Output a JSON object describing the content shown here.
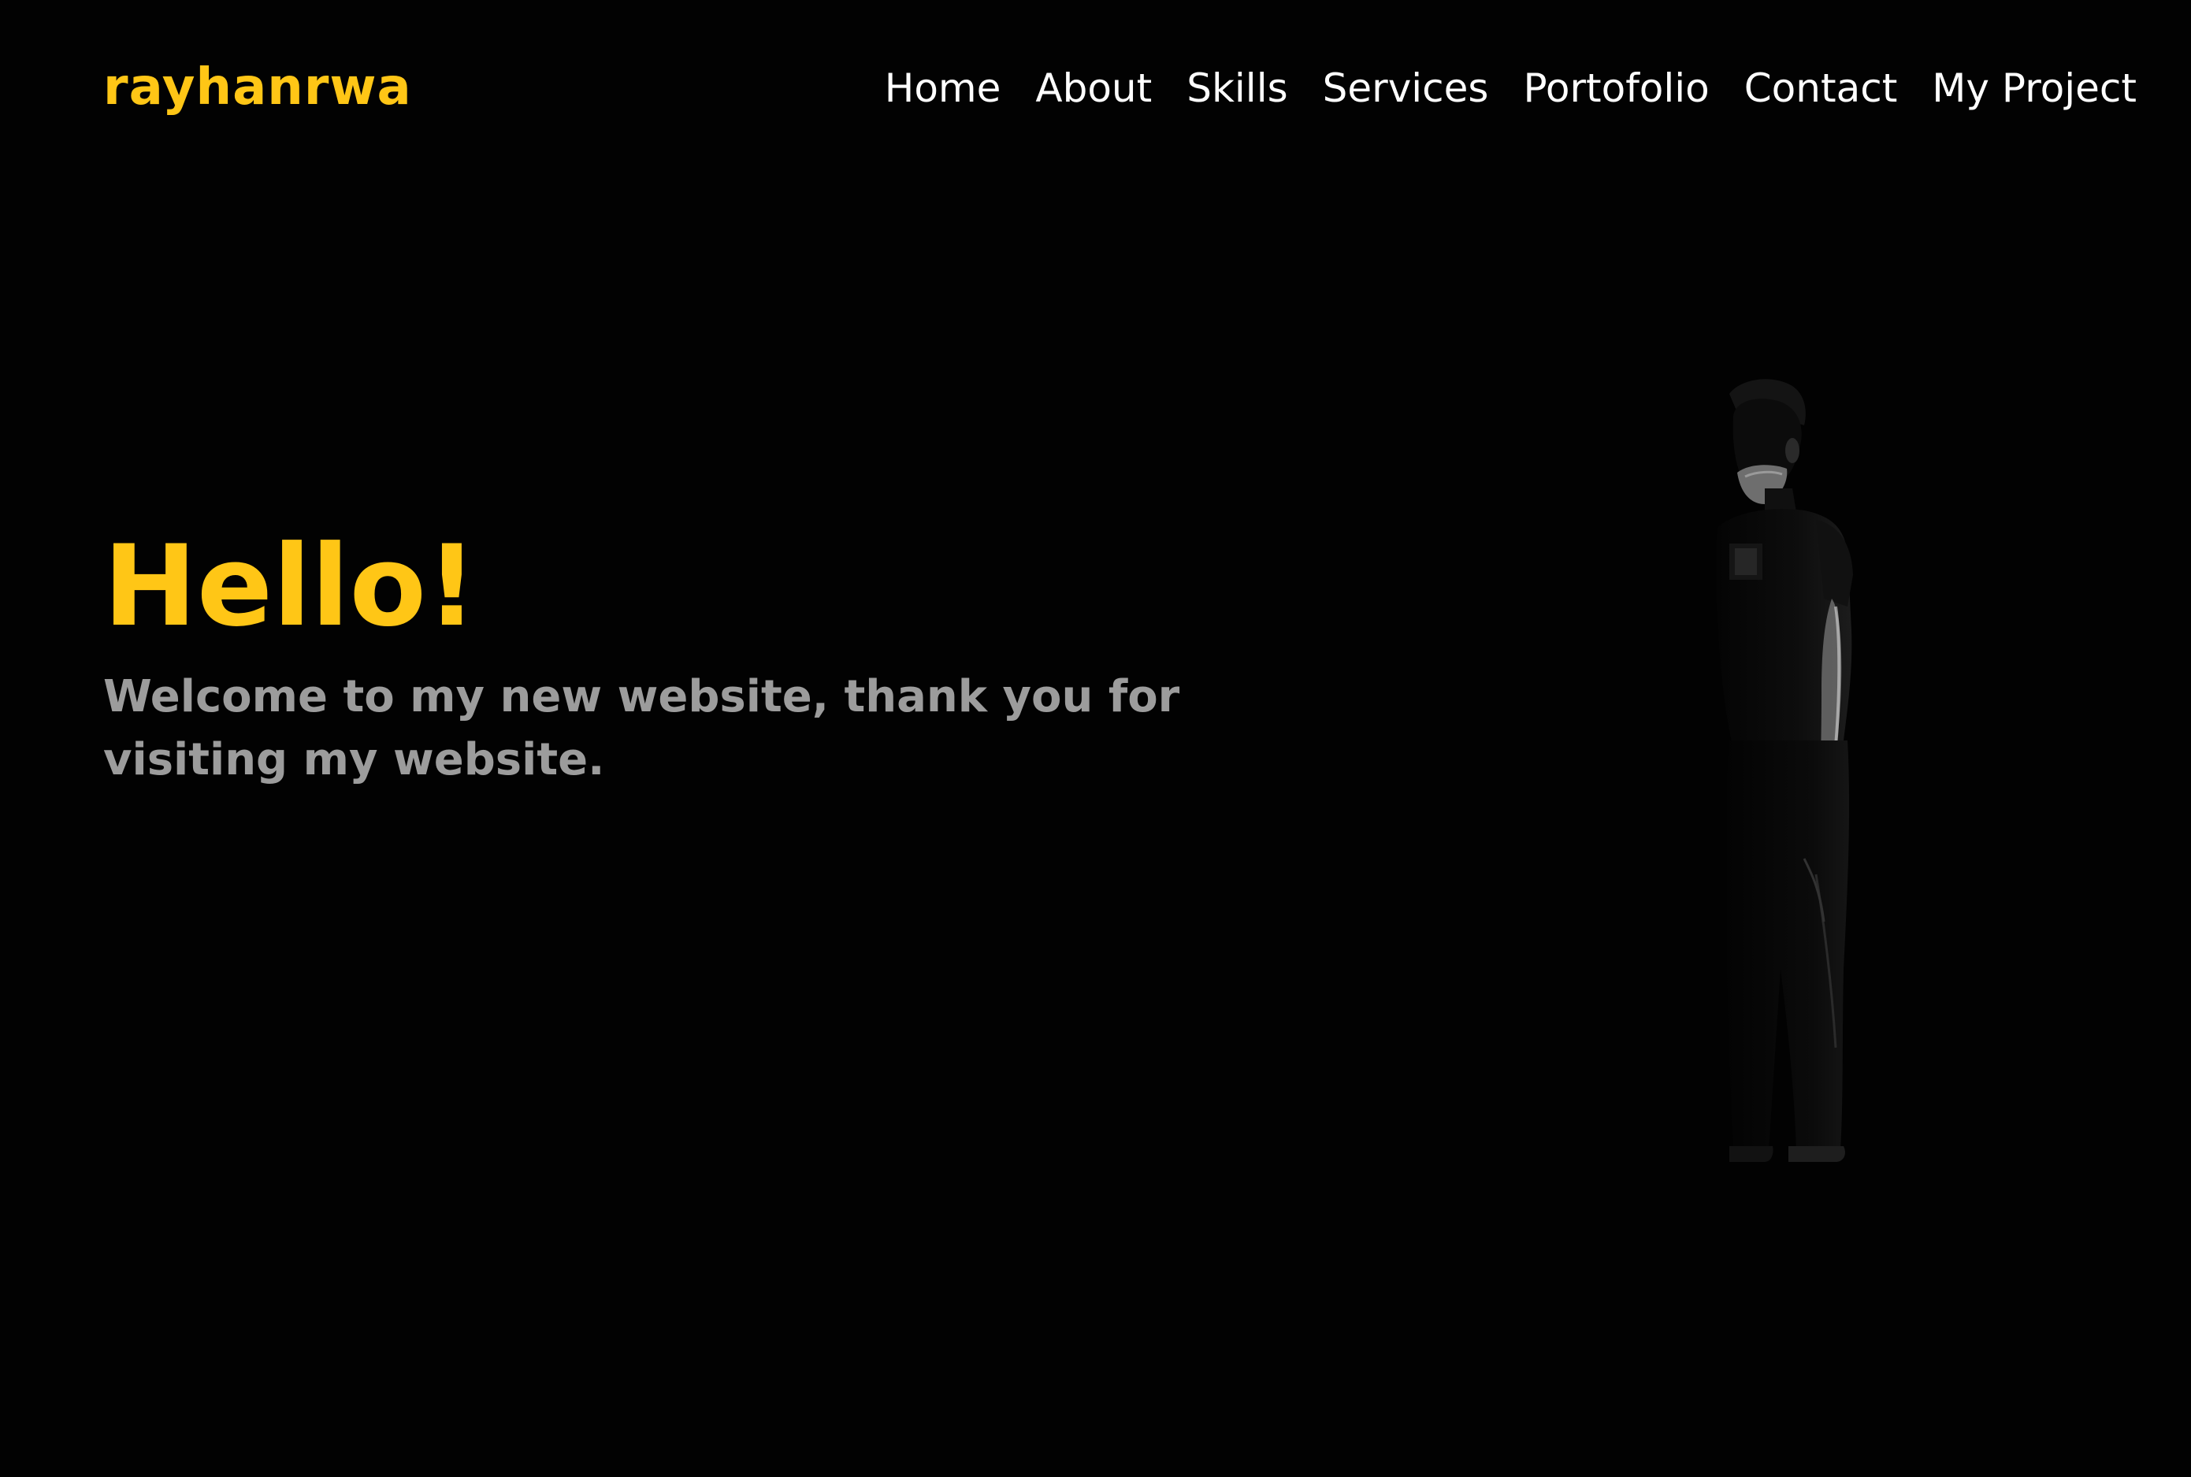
{
  "header": {
    "logo": "rayhanrwa",
    "nav": [
      {
        "label": "Home"
      },
      {
        "label": "About"
      },
      {
        "label": "Skills"
      },
      {
        "label": "Services"
      },
      {
        "label": "Portofolio"
      },
      {
        "label": "Contact"
      },
      {
        "label": "My Project"
      }
    ]
  },
  "hero": {
    "title": "Hello!",
    "subtitle": "Welcome to my new website, thank you for visiting my website."
  },
  "colors": {
    "background": "#020202",
    "accent": "#ffc616",
    "nav_text": "#ffffff",
    "subtitle_text": "#9c9c9c"
  }
}
